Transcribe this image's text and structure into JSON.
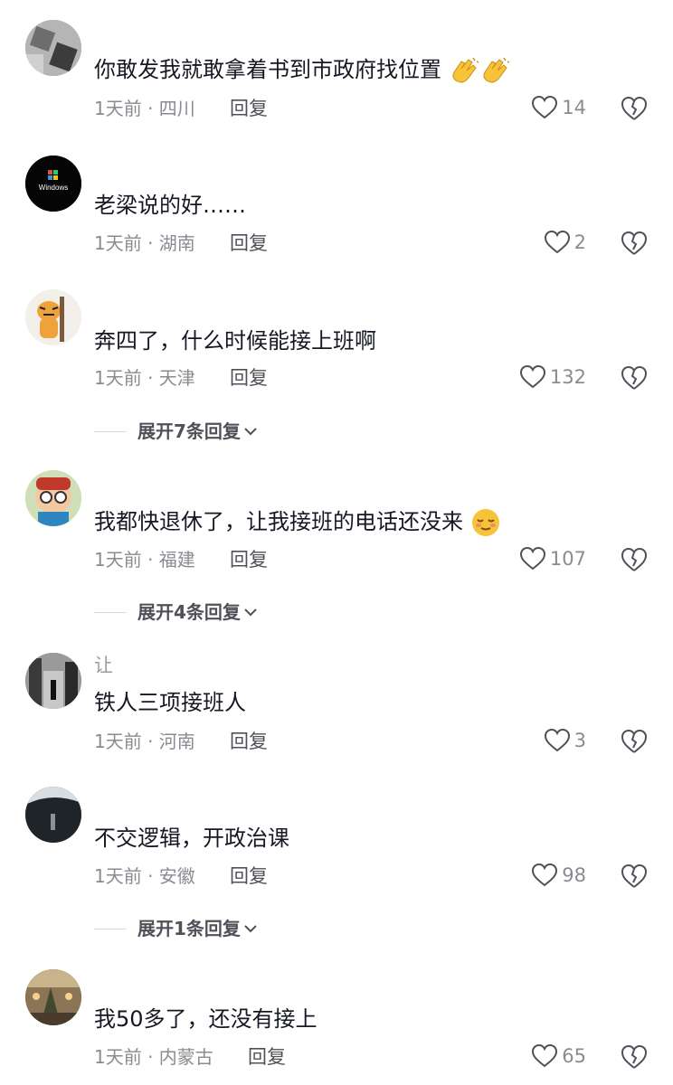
{
  "comments": [
    {
      "name": "",
      "text": "你敢发我就敢拿着书到市政府找位置",
      "emoji": "clap-emoji clap-emoji",
      "time": "1天前 · 四川",
      "reply": "回复",
      "likes": "14",
      "avatar": "gray-tile-avatar"
    },
    {
      "name": "",
      "avatar_text": "Windows",
      "text": "老梁说的好……",
      "time": "1天前 · 湖南",
      "reply": "回复",
      "likes": "2"
    },
    {
      "name": "",
      "text": "奔四了，什么时候能接上班啊",
      "time": "1天前 · 天津",
      "reply": "回复",
      "likes": "132",
      "expand": "展开7条回复"
    },
    {
      "name": "",
      "text": "我都快退休了，让我接班的电话还没来",
      "emoji": "relieved-face-emoji",
      "time": "1天前 · 福建",
      "reply": "回复",
      "likes": "107",
      "expand": "展开4条回复"
    },
    {
      "name": "让",
      "text": "铁人三项接班人",
      "time": "1天前 · 河南",
      "reply": "回复",
      "likes": "3"
    },
    {
      "name": "",
      "text": "不交逻辑，开政治课",
      "time": "1天前 · 安徽",
      "reply": "回复",
      "likes": "98",
      "expand": "展开1条回复"
    },
    {
      "name": "",
      "text": "我50多了，还没有接上",
      "time": "1天前 · 内蒙古",
      "reply": "回复",
      "likes": "65"
    }
  ],
  "colors": {
    "text": "#161823",
    "meta": "#8a8b91",
    "reply": "#505158",
    "emoji": "#f7c338"
  }
}
